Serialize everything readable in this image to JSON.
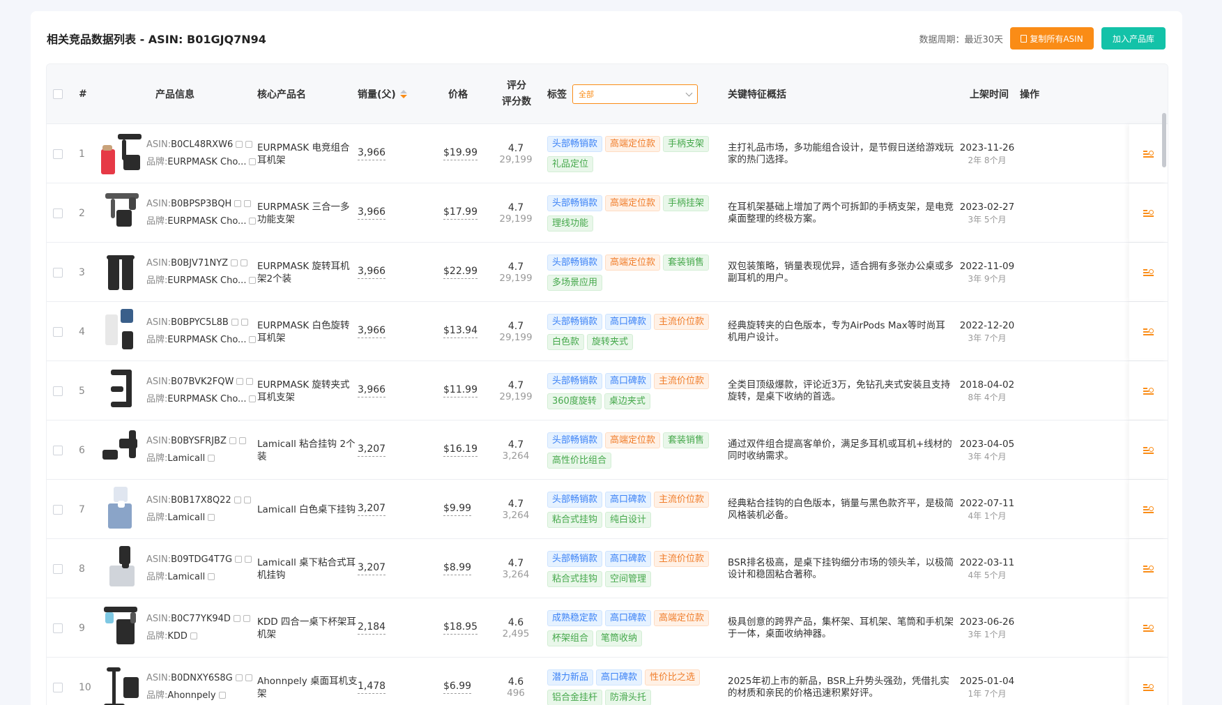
{
  "header": {
    "title": "相关竞品数据列表 - ASIN: B01GJQ7N94",
    "period": "数据周期：最近30天",
    "copy_button": "复制所有ASIN",
    "add_button": "加入产品库"
  },
  "columns": {
    "index": "#",
    "product": "产品信息",
    "core": "核心产品名",
    "sales": "销量(父)",
    "price": "价格",
    "rating_top": "评分",
    "rating_bottom": "评分数",
    "tags": "标签",
    "tag_filter": "全部",
    "summary": "关键特征概括",
    "launch": "上架时间",
    "action": "操作"
  },
  "rows": [
    {
      "idx": "1",
      "asin": "B0CL48RXW6",
      "brand": "EURPMASK Cho...",
      "core": "EURPMASK 电竞组合耳机架",
      "sales": "3,966",
      "price": "$19.99",
      "rating": "4.7",
      "count": "29,199",
      "tags": [
        {
          "t": "头部畅销款",
          "c": "blue"
        },
        {
          "t": "高端定位款",
          "c": "orange"
        },
        {
          "t": "手柄支架",
          "c": "green"
        },
        {
          "t": "礼品定位",
          "c": "green"
        }
      ],
      "summary": "主打礼品市场，多功能组合设计，是节假日送给游戏玩家的热门选择。",
      "date": "2023-11-26",
      "age": "2年 8个月",
      "thumb": "gift"
    },
    {
      "idx": "2",
      "asin": "B0BPSP3BQH",
      "brand": "EURPMASK Cho...",
      "core": "EURPMASK 三合一多功能支架",
      "sales": "3,966",
      "price": "$17.99",
      "rating": "4.7",
      "count": "29,199",
      "tags": [
        {
          "t": "头部畅销款",
          "c": "blue"
        },
        {
          "t": "高端定位款",
          "c": "orange"
        },
        {
          "t": "手柄挂架",
          "c": "green"
        },
        {
          "t": "理线功能",
          "c": "green"
        }
      ],
      "summary": "在耳机架基础上增加了两个可拆卸的手柄支架，是电竞桌面整理的终极方案。",
      "date": "2023-02-27",
      "age": "3年 5个月",
      "thumb": "multi"
    },
    {
      "idx": "3",
      "asin": "B0BJV71NYZ",
      "brand": "EURPMASK Cho...",
      "core": "EURPMASK 旋转耳机架2个装",
      "sales": "3,966",
      "price": "$22.99",
      "rating": "4.7",
      "count": "29,199",
      "tags": [
        {
          "t": "头部畅销款",
          "c": "blue"
        },
        {
          "t": "高端定位款",
          "c": "orange"
        },
        {
          "t": "套装销售",
          "c": "green"
        },
        {
          "t": "多场景应用",
          "c": "green"
        }
      ],
      "summary": "双包装策略，销量表现优异，适合拥有多张办公桌或多副耳机的用户。",
      "date": "2022-11-09",
      "age": "3年 9个月",
      "thumb": "double"
    },
    {
      "idx": "4",
      "asin": "B0BPYC5L8B",
      "brand": "EURPMASK Cho...",
      "core": "EURPMASK 白色旋转耳机架",
      "sales": "3,966",
      "price": "$13.94",
      "rating": "4.7",
      "count": "29,199",
      "tags": [
        {
          "t": "头部畅销款",
          "c": "blue"
        },
        {
          "t": "高口碑款",
          "c": "blue"
        },
        {
          "t": "主流价位款",
          "c": "orange"
        },
        {
          "t": "白色款",
          "c": "green"
        },
        {
          "t": "旋转夹式",
          "c": "green"
        }
      ],
      "summary": "经典旋转夹的白色版本，专为AirPods Max等时尚耳机用户设计。",
      "date": "2022-12-20",
      "age": "3年 7个月",
      "thumb": "white"
    },
    {
      "idx": "5",
      "asin": "B07BVK2FQW",
      "brand": "EURPMASK Cho...",
      "core": "EURPMASK 旋转夹式耳机支架",
      "sales": "3,966",
      "price": "$11.99",
      "rating": "4.7",
      "count": "29,199",
      "tags": [
        {
          "t": "头部畅销款",
          "c": "blue"
        },
        {
          "t": "高口碑款",
          "c": "blue"
        },
        {
          "t": "主流价位款",
          "c": "orange"
        },
        {
          "t": "360度旋转",
          "c": "green"
        },
        {
          "t": "桌边夹式",
          "c": "green"
        }
      ],
      "summary": "全类目顶级爆款，评论近3万，免钻孔夹式安装且支持旋转，是桌下收纳的首选。",
      "date": "2018-04-02",
      "age": "8年 4个月",
      "thumb": "clamp"
    },
    {
      "idx": "6",
      "asin": "B0BYSFRJBZ",
      "brand": "Lamicall",
      "core": "Lamicall 粘合挂钩 2个装",
      "sales": "3,207",
      "price": "$16.19",
      "rating": "4.7",
      "count": "3,264",
      "tags": [
        {
          "t": "头部畅销款",
          "c": "blue"
        },
        {
          "t": "高端定位款",
          "c": "orange"
        },
        {
          "t": "套装销售",
          "c": "green"
        },
        {
          "t": "高性价比组合",
          "c": "green"
        }
      ],
      "summary": "通过双件组合提高客单价，满足多耳机或耳机+线材的同时收纳需求。",
      "date": "2023-04-05",
      "age": "3年 4个月",
      "thumb": "hook2"
    },
    {
      "idx": "7",
      "asin": "B0B17X8Q22",
      "brand": "Lamicall",
      "core": "Lamicall 白色桌下挂钩",
      "sales": "3,207",
      "price": "$9.99",
      "rating": "4.7",
      "count": "3,264",
      "tags": [
        {
          "t": "头部畅销款",
          "c": "blue"
        },
        {
          "t": "高口碑款",
          "c": "blue"
        },
        {
          "t": "主流价位款",
          "c": "orange"
        },
        {
          "t": "粘合式挂钩",
          "c": "green"
        },
        {
          "t": "纯白设计",
          "c": "green"
        }
      ],
      "summary": "经典粘合挂钩的白色版本，销量与黑色款齐平，是极简风格装机必备。",
      "date": "2022-07-11",
      "age": "4年 1个月",
      "thumb": "hookw"
    },
    {
      "idx": "8",
      "asin": "B09TDG4T7G",
      "brand": "Lamicall",
      "core": "Lamicall 桌下粘合式耳机挂钩",
      "sales": "3,207",
      "price": "$8.99",
      "rating": "4.7",
      "count": "3,264",
      "tags": [
        {
          "t": "头部畅销款",
          "c": "blue"
        },
        {
          "t": "高口碑款",
          "c": "blue"
        },
        {
          "t": "主流价位款",
          "c": "orange"
        },
        {
          "t": "粘合式挂钩",
          "c": "green"
        },
        {
          "t": "空间管理",
          "c": "green"
        }
      ],
      "summary": "BSR排名极高，是桌下挂钩细分市场的领头羊，以极简设计和稳固粘合著称。",
      "date": "2022-03-11",
      "age": "4年 5个月",
      "thumb": "hookb"
    },
    {
      "idx": "9",
      "asin": "B0C77YK94D",
      "brand": "KDD",
      "core": "KDD 四合一桌下杯架耳机架",
      "sales": "2,184",
      "price": "$18.95",
      "rating": "4.6",
      "count": "2,495",
      "tags": [
        {
          "t": "成熟稳定款",
          "c": "blue"
        },
        {
          "t": "高口碑款",
          "c": "blue"
        },
        {
          "t": "高端定位款",
          "c": "orange"
        },
        {
          "t": "杯架组合",
          "c": "green"
        },
        {
          "t": "笔筒收纳",
          "c": "green"
        }
      ],
      "summary": "极具创意的跨界产品，集杯架、耳机架、笔筒和手机架于一体，桌面收纳神器。",
      "date": "2023-06-26",
      "age": "3年 1个月",
      "thumb": "cup"
    },
    {
      "idx": "10",
      "asin": "B0DNXY6S8G",
      "brand": "Ahonnpely",
      "core": "Ahonnpely 桌面耳机支架",
      "sales": "1,478",
      "price": "$6.99",
      "rating": "4.6",
      "count": "496",
      "tags": [
        {
          "t": "潜力新品",
          "c": "blue"
        },
        {
          "t": "高口碑款",
          "c": "blue"
        },
        {
          "t": "性价比之选",
          "c": "orange"
        },
        {
          "t": "铝合金挂杆",
          "c": "green"
        },
        {
          "t": "防滑头托",
          "c": "green"
        }
      ],
      "summary": "2025年初上市的新品，BSR上升势头强劲，凭借扎实的材质和亲民的价格迅速积累好评。",
      "date": "2025-01-04",
      "age": "1年 7个月",
      "thumb": "stand"
    }
  ]
}
